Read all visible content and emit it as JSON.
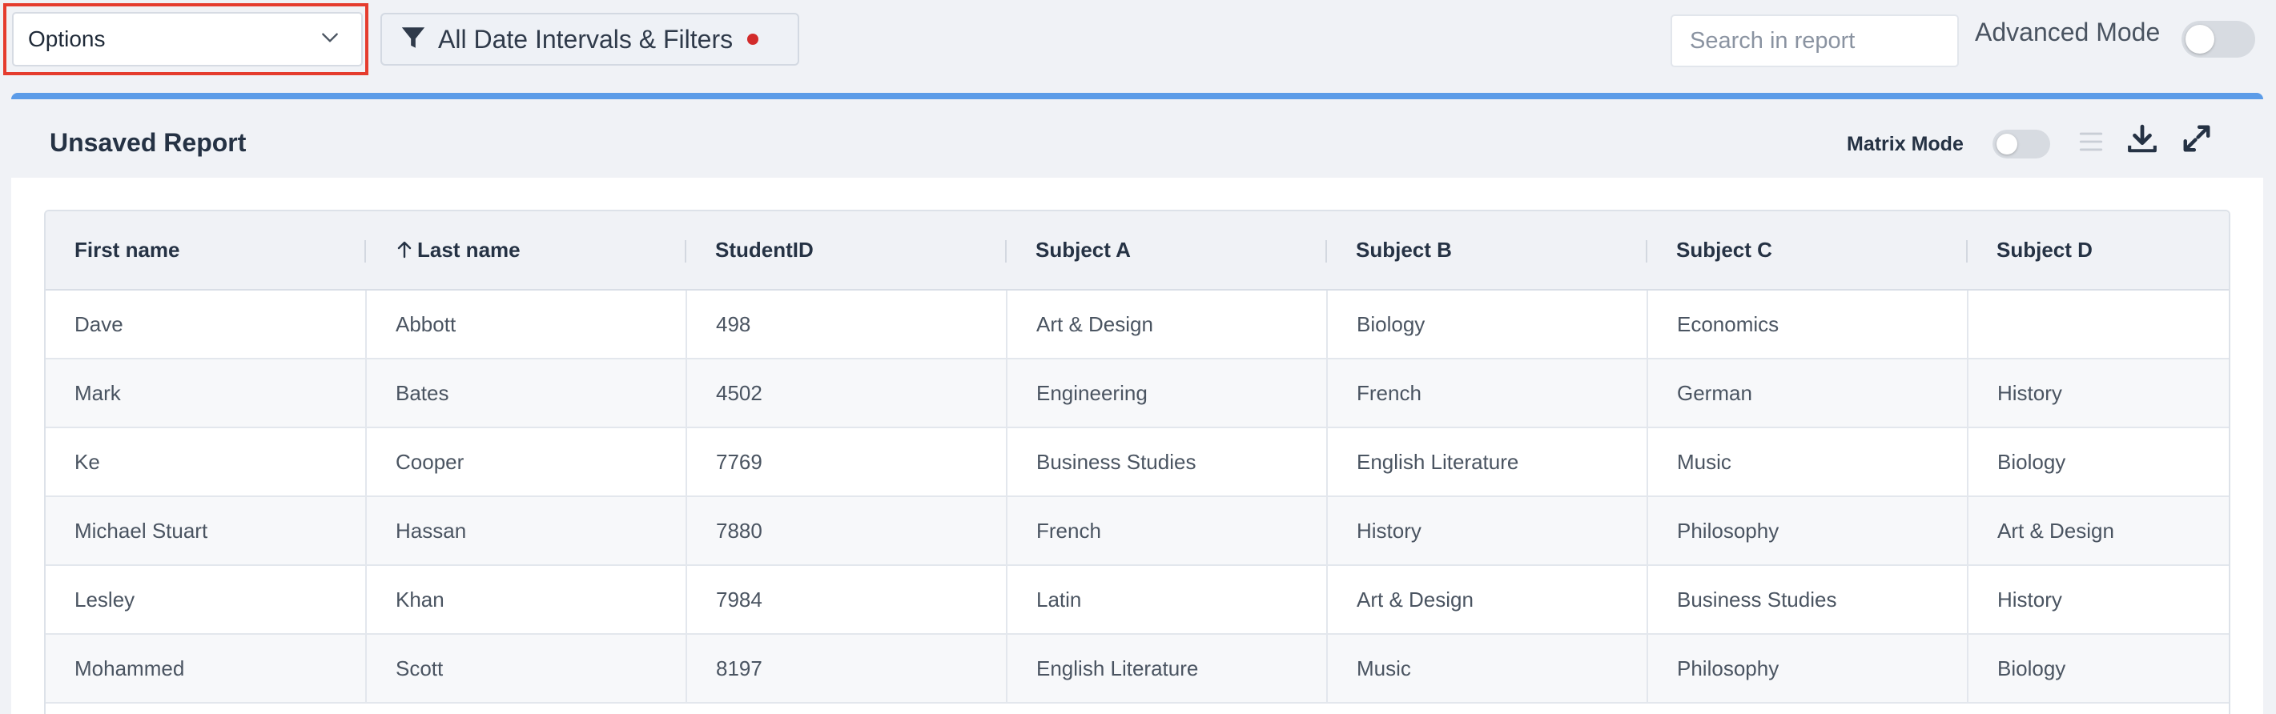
{
  "toolbar": {
    "options_label": "Options",
    "filters_label": "All Date Intervals & Filters",
    "search_placeholder": "Search in report",
    "advanced_mode_label": "Advanced Mode"
  },
  "report": {
    "title": "Unsaved Report",
    "matrix_mode_label": "Matrix Mode"
  },
  "table": {
    "columns": [
      "First name",
      "Last name",
      "StudentID",
      "Subject A",
      "Subject B",
      "Subject C",
      "Subject D"
    ],
    "rows": [
      [
        "Dave",
        "Abbott",
        "498",
        "Art & Design",
        "Biology",
        "Economics",
        ""
      ],
      [
        "Mark",
        "Bates",
        "4502",
        "Engineering",
        "French",
        "German",
        "History"
      ],
      [
        "Ke",
        "Cooper",
        "7769",
        "Business Studies",
        "English Literature",
        "Music",
        "Biology"
      ],
      [
        "Michael Stuart",
        "Hassan",
        "7880",
        "French",
        "History",
        "Philosophy",
        "Art & Design"
      ],
      [
        "Lesley",
        "Khan",
        "7984",
        "Latin",
        "Art & Design",
        "Business Studies",
        "History"
      ],
      [
        "Mohammed",
        "Scott",
        "8197",
        "English Literature",
        "Music",
        "Philosophy",
        "Biology"
      ]
    ]
  },
  "colors": {
    "accent": "#5c9ce8",
    "highlight": "#e53c2e",
    "filter_dot": "#d22b2b"
  }
}
